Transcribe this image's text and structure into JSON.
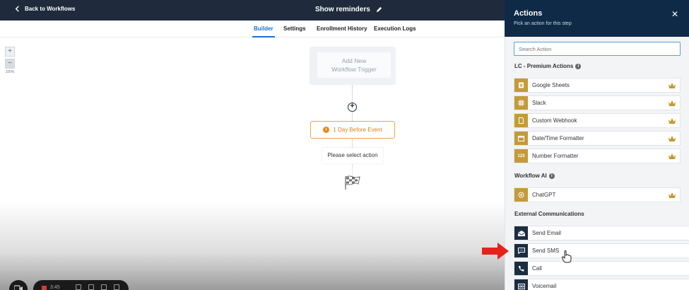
{
  "topbar": {
    "back_label": "Back to Workflows",
    "workflow_title": "Show reminders"
  },
  "tabs": [
    {
      "label": "Builder",
      "active": true
    },
    {
      "label": "Settings",
      "active": false
    },
    {
      "label": "Enrollment History",
      "active": false
    },
    {
      "label": "Execution Logs",
      "active": false
    }
  ],
  "canvas": {
    "zoom_in": "+",
    "zoom_out": "−",
    "zoom_level": "100%",
    "trigger_line1": "Add New",
    "trigger_line2": "Workflow Trigger",
    "add_step": "+",
    "event_node": "1 Day Before Event",
    "select_action": "Please select action"
  },
  "recorder": {
    "time": "3:45"
  },
  "panel": {
    "title": "Actions",
    "subtitle": "Pick an action for this step",
    "close": "✕",
    "search_placeholder": "Search Action",
    "section_premium": "LC - Premium Actions",
    "section_ai": "Workflow AI",
    "section_external": "External Communications",
    "premium_actions": [
      {
        "label": "Google Sheets",
        "icon": "sheets-icon"
      },
      {
        "label": "Slack",
        "icon": "slack-icon"
      },
      {
        "label": "Custom Webhook",
        "icon": "webhook-icon"
      },
      {
        "label": "Date/Time Formatter",
        "icon": "calendar-icon"
      },
      {
        "label": "Number Formatter",
        "icon": "number-icon"
      }
    ],
    "ai_actions": [
      {
        "label": "ChatGPT",
        "icon": "chatgpt-icon"
      }
    ],
    "external_actions": [
      {
        "label": "Send Email",
        "icon": "email-icon"
      },
      {
        "label": "Send SMS",
        "icon": "sms-icon"
      },
      {
        "label": "Call",
        "icon": "phone-icon"
      },
      {
        "label": "Voicemail",
        "icon": "voicemail-icon"
      }
    ]
  },
  "colors": {
    "topbar": "#1f2b3c",
    "panel_header": "#0f2a47",
    "accent": "#1d6fd6",
    "premium_icon": "#c49a3a",
    "event_orange": "#f0a24b",
    "arrow_red": "#e5221c"
  }
}
